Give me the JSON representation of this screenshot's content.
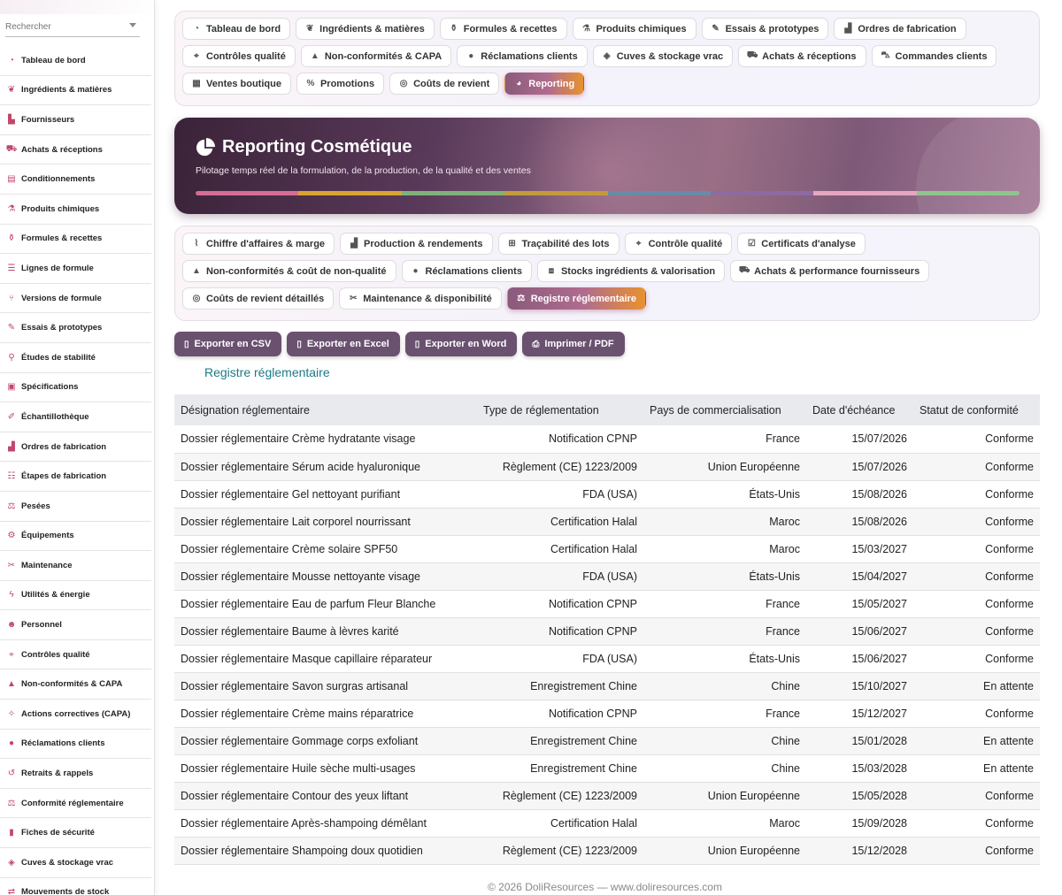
{
  "sidebar": {
    "search_placeholder": "Rechercher",
    "items": [
      {
        "label": "Tableau de bord",
        "icon": "gauge-icon"
      },
      {
        "label": "Ingrédients & matières",
        "icon": "leaf-icon"
      },
      {
        "label": "Fournisseurs",
        "icon": "factory-icon"
      },
      {
        "label": "Achats & réceptions",
        "icon": "dolly-icon"
      },
      {
        "label": "Conditionnements",
        "icon": "box-icon"
      },
      {
        "label": "Produits chimiques",
        "icon": "flask-icon"
      },
      {
        "label": "Formules & recettes",
        "icon": "beaker-icon"
      },
      {
        "label": "Lignes de formule",
        "icon": "list-icon"
      },
      {
        "label": "Versions de formule",
        "icon": "branch-icon"
      },
      {
        "label": "Essais & prototypes",
        "icon": "pen-icon"
      },
      {
        "label": "Études de stabilité",
        "icon": "vial-icon"
      },
      {
        "label": "Spécifications",
        "icon": "clipboard-icon"
      },
      {
        "label": "Échantillothèque",
        "icon": "eyedropper-icon"
      },
      {
        "label": "Ordres de fabrication",
        "icon": "industry-icon"
      },
      {
        "label": "Étapes de fabrication",
        "icon": "list-ordered-icon"
      },
      {
        "label": "Pesées",
        "icon": "scale-icon"
      },
      {
        "label": "Équipements",
        "icon": "gears-icon"
      },
      {
        "label": "Maintenance",
        "icon": "tools-icon"
      },
      {
        "label": "Utilités & énergie",
        "icon": "bolt-icon"
      },
      {
        "label": "Personnel",
        "icon": "users-icon"
      },
      {
        "label": "Contrôles qualité",
        "icon": "microscope-icon"
      },
      {
        "label": "Non-conformités & CAPA",
        "icon": "warning-icon"
      },
      {
        "label": "Actions correctives (CAPA)",
        "icon": "wrench-icon"
      },
      {
        "label": "Réclamations clients",
        "icon": "comment-icon"
      },
      {
        "label": "Retraits & rappels",
        "icon": "undo-icon"
      },
      {
        "label": "Conformité réglementaire",
        "icon": "scale-balance-icon"
      },
      {
        "label": "Fiches de sécurité",
        "icon": "file-icon"
      },
      {
        "label": "Cuves & stockage vrac",
        "icon": "fill-drip-icon"
      },
      {
        "label": "Mouvements de stock",
        "icon": "arrows-icon"
      }
    ]
  },
  "main_tabs": [
    {
      "label": "Tableau de bord",
      "icon": "gauge-icon"
    },
    {
      "label": "Ingrédients & matières",
      "icon": "leaf-icon"
    },
    {
      "label": "Formules & recettes",
      "icon": "beaker-icon"
    },
    {
      "label": "Produits chimiques",
      "icon": "flask-icon"
    },
    {
      "label": "Essais & prototypes",
      "icon": "pen-icon"
    },
    {
      "label": "Ordres de fabrication",
      "icon": "industry-icon"
    },
    {
      "label": "Contrôles qualité",
      "icon": "microscope-icon"
    },
    {
      "label": "Non-conformités & CAPA",
      "icon": "warning-icon"
    },
    {
      "label": "Réclamations clients",
      "icon": "comment-icon"
    },
    {
      "label": "Cuves & stockage vrac",
      "icon": "fill-drip-icon"
    },
    {
      "label": "Achats & réceptions",
      "icon": "dolly-icon"
    },
    {
      "label": "Commandes clients",
      "icon": "cart-icon"
    },
    {
      "label": "Ventes boutique",
      "icon": "cash-register-icon"
    },
    {
      "label": "Promotions",
      "icon": "percent-icon"
    },
    {
      "label": "Coûts de revient",
      "icon": "coins-icon"
    },
    {
      "label": "Reporting",
      "icon": "chart-pie-icon",
      "active": true
    }
  ],
  "hero": {
    "title": "Reporting Cosmétique",
    "subtitle": "Pilotage temps réel de la formulation, de la production, de la qualité et des ventes",
    "bar_colors": [
      "#d56d96",
      "#d9a431",
      "#7fb27a",
      "#c49a3a",
      "#6a8aa8",
      "#8d6aa0",
      "#e7a6c0",
      "#8fc58c"
    ]
  },
  "report_tabs": [
    {
      "label": "Chiffre d'affaires & marge",
      "icon": "chart-line-icon"
    },
    {
      "label": "Production & rendements",
      "icon": "industry-icon"
    },
    {
      "label": "Traçabilité des lots",
      "icon": "sitemap-icon"
    },
    {
      "label": "Contrôle qualité",
      "icon": "microscope-icon"
    },
    {
      "label": "Certificats d'analyse",
      "icon": "clipboard-check-icon"
    },
    {
      "label": "Non-conformités & coût de non-qualité",
      "icon": "warning-icon"
    },
    {
      "label": "Réclamations clients",
      "icon": "comment-icon"
    },
    {
      "label": "Stocks ingrédients & valorisation",
      "icon": "cubes-icon"
    },
    {
      "label": "Achats & performance fournisseurs",
      "icon": "dolly-icon"
    },
    {
      "label": "Coûts de revient détaillés",
      "icon": "coins-icon"
    },
    {
      "label": "Maintenance & disponibilité",
      "icon": "tools-icon"
    },
    {
      "label": "Registre réglementaire",
      "icon": "scale-balance-icon",
      "active": true
    }
  ],
  "export_buttons": [
    {
      "label": "Exporter en CSV",
      "icon": "file-csv-icon"
    },
    {
      "label": "Exporter en Excel",
      "icon": "file-excel-icon"
    },
    {
      "label": "Exporter en Word",
      "icon": "file-word-icon"
    },
    {
      "label": "Imprimer / PDF",
      "icon": "print-icon"
    }
  ],
  "section_title": "Registre réglementaire",
  "table": {
    "columns": [
      "Désignation réglementaire",
      "Type de réglementation",
      "Pays de commercialisation",
      "Date d'échéance",
      "Statut de conformité"
    ],
    "rows": [
      [
        "Dossier réglementaire Crème hydratante visage",
        "Notification CPNP",
        "France",
        "15/07/2026",
        "Conforme"
      ],
      [
        "Dossier réglementaire Sérum acide hyaluronique",
        "Règlement (CE) 1223/2009",
        "Union Européenne",
        "15/07/2026",
        "Conforme"
      ],
      [
        "Dossier réglementaire Gel nettoyant purifiant",
        "FDA (USA)",
        "États-Unis",
        "15/08/2026",
        "Conforme"
      ],
      [
        "Dossier réglementaire Lait corporel nourrissant",
        "Certification Halal",
        "Maroc",
        "15/08/2026",
        "Conforme"
      ],
      [
        "Dossier réglementaire Crème solaire SPF50",
        "Certification Halal",
        "Maroc",
        "15/03/2027",
        "Conforme"
      ],
      [
        "Dossier réglementaire Mousse nettoyante visage",
        "FDA (USA)",
        "États-Unis",
        "15/04/2027",
        "Conforme"
      ],
      [
        "Dossier réglementaire Eau de parfum Fleur Blanche",
        "Notification CPNP",
        "France",
        "15/05/2027",
        "Conforme"
      ],
      [
        "Dossier réglementaire Baume à lèvres karité",
        "Notification CPNP",
        "France",
        "15/06/2027",
        "Conforme"
      ],
      [
        "Dossier réglementaire Masque capillaire réparateur",
        "FDA (USA)",
        "États-Unis",
        "15/06/2027",
        "Conforme"
      ],
      [
        "Dossier réglementaire Savon surgras artisanal",
        "Enregistrement Chine",
        "Chine",
        "15/10/2027",
        "En attente"
      ],
      [
        "Dossier réglementaire Crème mains réparatrice",
        "Notification CPNP",
        "France",
        "15/12/2027",
        "Conforme"
      ],
      [
        "Dossier réglementaire Gommage corps exfoliant",
        "Enregistrement Chine",
        "Chine",
        "15/01/2028",
        "En attente"
      ],
      [
        "Dossier réglementaire Huile sèche multi-usages",
        "Enregistrement Chine",
        "Chine",
        "15/03/2028",
        "En attente"
      ],
      [
        "Dossier réglementaire Contour des yeux liftant",
        "Règlement (CE) 1223/2009",
        "Union Européenne",
        "15/05/2028",
        "Conforme"
      ],
      [
        "Dossier réglementaire Après-shampoing démêlant",
        "Certification Halal",
        "Maroc",
        "15/09/2028",
        "Conforme"
      ],
      [
        "Dossier réglementaire Shampoing doux quotidien",
        "Règlement (CE) 1223/2009",
        "Union Européenne",
        "15/12/2028",
        "Conforme"
      ]
    ]
  },
  "footer": "© 2026 DoliResources — www.doliresources.com"
}
